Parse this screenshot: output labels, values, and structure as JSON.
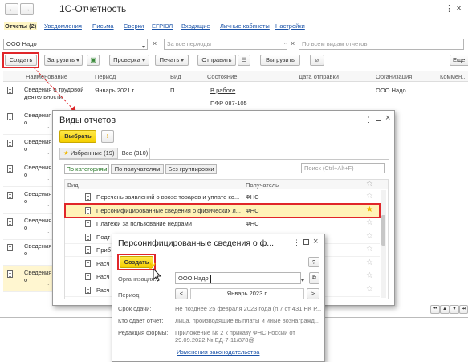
{
  "app": {
    "title": "1С-Отчетность",
    "nav_back": "←",
    "nav_fwd": "→",
    "title_more": "⋮",
    "title_close": "×"
  },
  "tabs": [
    "Отчеты (2)",
    "Уведомления",
    "Письма",
    "Сверки",
    "ЕГРЮЛ",
    "Входящие",
    "Личные кабинеты",
    "Настройки"
  ],
  "filters": {
    "org": "ООО Надо",
    "period_placeholder": "За все периоды",
    "types_placeholder": "По всем видам отчетов"
  },
  "toolbar": {
    "create": "Создать",
    "sent": "Загрузить",
    "check": "Проверка",
    "print": "Печать",
    "send": "Отправить",
    "upload": "Выгрузить",
    "more": "Еще"
  },
  "table": {
    "columns": [
      "Наименование",
      "Период",
      "Вид",
      "Состояние",
      "Дата отправки",
      "Организация",
      "Коммен..."
    ],
    "first_row": {
      "name": "Сведения о трудовой деятельности",
      "period": "Январь 2021 г.",
      "kind": "П",
      "state": "В работе",
      "state_sub": "ПФР 087-105",
      "org": "ООО Надо"
    },
    "left_rows": [
      "Сведения о трудовой деятельности",
      "Сведения о трудовой деятельности",
      "Сведения о трудовой деятельности",
      "Сведения о трудовой деятельности",
      "Сведения о трудовой деятельности",
      "Сведения о трудовой деятельности",
      "Сведения о трудовой деятельности"
    ]
  },
  "kinds_dialog": {
    "title": "Виды отчетов",
    "choose": "Выбрать",
    "tab_fav": "Избранные (19)",
    "tab_all": "Все (310)",
    "seg_cat": "По категориям",
    "seg_recv": "По получателям",
    "seg_none": "Без группировки",
    "search_placeholder": "Поиск (Ctrl+Alt+F)",
    "col_kind": "Вид",
    "col_recv": "Получатель",
    "rows": [
      {
        "name": "Перечень заявлений о ввозе товаров и уплате ко...",
        "recv": "ФНС"
      },
      {
        "name": "Персонифицированные сведения о физических л...",
        "recv": "ФНС"
      },
      {
        "name": "Платежи за пользование недрами",
        "recv": "ФНС"
      },
      {
        "name": "Подт",
        "recv": ""
      },
      {
        "name": "Приб",
        "recv": ""
      },
      {
        "name": "Расч",
        "recv": ""
      },
      {
        "name": "Расч",
        "recv": ""
      },
      {
        "name": "Расч",
        "recv": ""
      }
    ]
  },
  "pers_dialog": {
    "title": "Персонифицированные сведения о ф...",
    "create": "Создать",
    "help": "?",
    "org_label": "Организация:",
    "org_value": "ООО Надо",
    "period_label": "Период:",
    "period_value": "Январь 2023 г.",
    "due_label": "Срок сдачи:",
    "due_value": "Не позднее 25 февраля 2023 года (п.7 ст 431 НК Р...",
    "who_label": "Кто сдает отчет:",
    "who_value": "Лица, производящие выплаты и иные вознагражд...",
    "form_label": "Редакция формы:",
    "form_value": "Приложение № 2 к приказу ФНС России от 29.09.2022 № ЕД-7-11/878@",
    "law_link": "Изменения законодательства"
  },
  "pager": {
    "first": "⏮",
    "prev": "▲",
    "next": "▼",
    "last": "⏭"
  }
}
